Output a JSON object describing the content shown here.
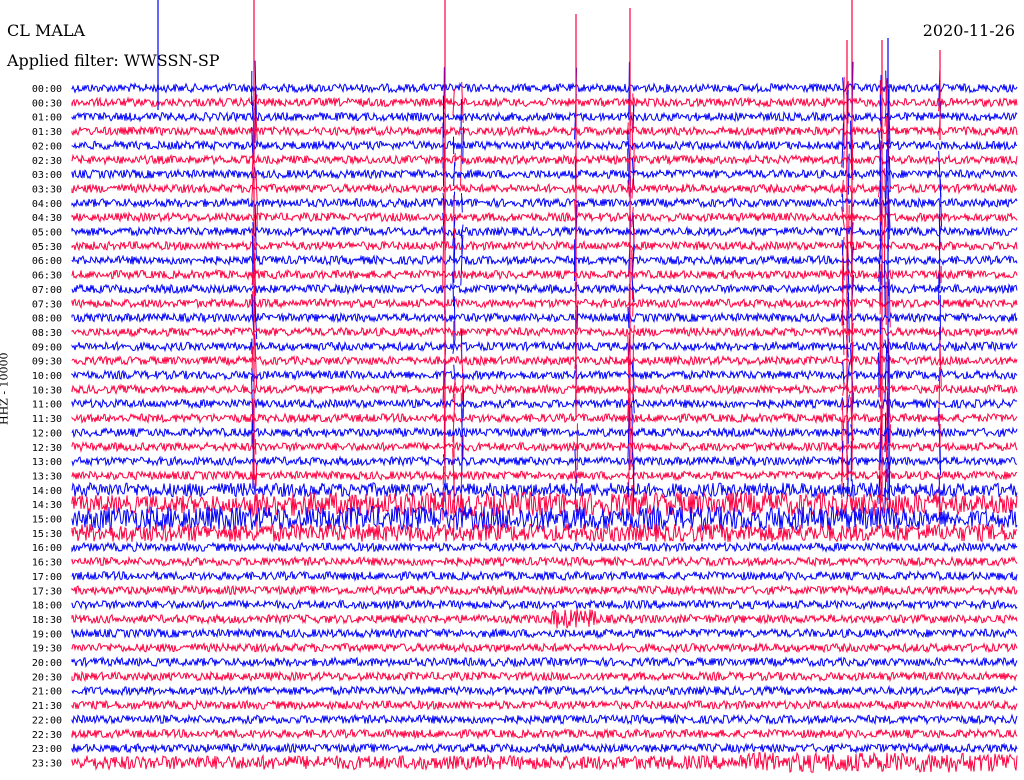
{
  "header": {
    "station": "CL MALA",
    "filter": "Applied filter: WWSSN-SP",
    "date": "2020-11-26"
  },
  "chart_data": {
    "type": "line",
    "title": "CL MALA",
    "subtitle": "Applied filter: WWSSN-SP",
    "ylabel": "HHZ - 10000",
    "xlabel": "",
    "rows": [
      "00:00",
      "00:30",
      "01:00",
      "01:30",
      "02:00",
      "02:30",
      "03:00",
      "03:30",
      "04:00",
      "04:30",
      "05:00",
      "05:30",
      "06:00",
      "06:30",
      "07:00",
      "07:30",
      "08:00",
      "08:30",
      "09:00",
      "09:30",
      "10:00",
      "10:30",
      "11:00",
      "11:30",
      "12:00",
      "12:30",
      "13:00",
      "13:30",
      "14:00",
      "14:30",
      "15:00",
      "15:30",
      "16:00",
      "16:30",
      "17:00",
      "17:30",
      "18:00",
      "18:30",
      "19:00",
      "19:30",
      "20:00",
      "20:30",
      "21:00",
      "21:30",
      "22:00",
      "22:30",
      "23:00",
      "23:30"
    ],
    "row_colors": [
      "#0000ff",
      "#ff0040"
    ],
    "grid": false,
    "legend": "none"
  }
}
